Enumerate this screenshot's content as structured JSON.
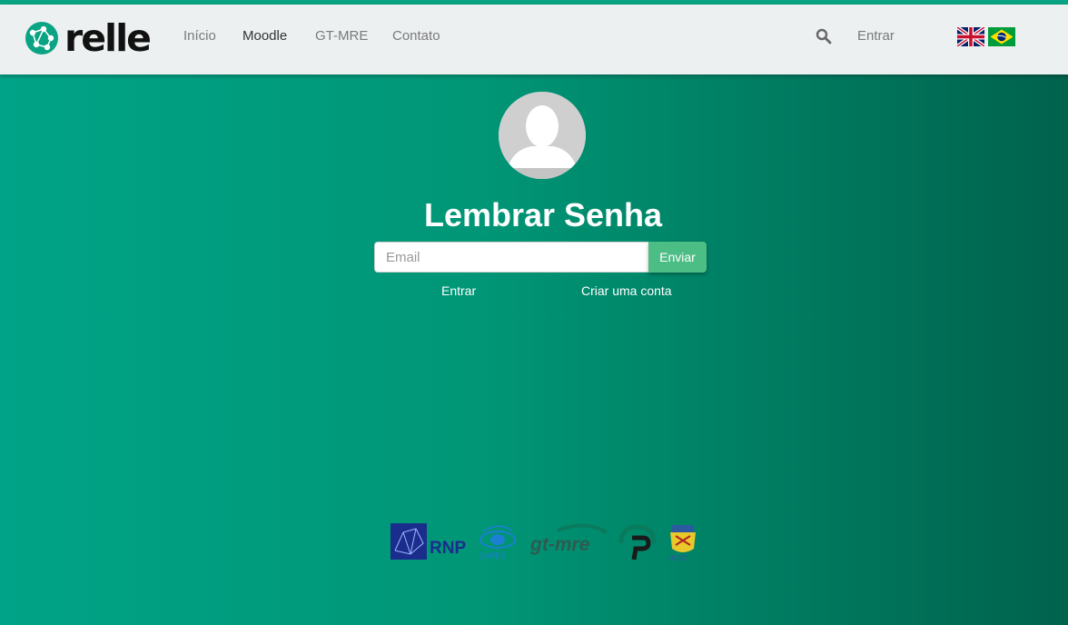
{
  "brand": {
    "name": "relle",
    "accent": "#0aa383"
  },
  "nav": {
    "items": [
      {
        "label": "Início",
        "active": false
      },
      {
        "label": "Moodle",
        "active": true
      },
      {
        "label": "GT-MRE",
        "active": false
      },
      {
        "label": "Contato",
        "active": false
      }
    ],
    "login_label": "Entrar",
    "search_icon": "search-icon",
    "languages": [
      "english-flag-icon",
      "brazil-flag-icon"
    ]
  },
  "page": {
    "title": "Lembrar Senha",
    "email_placeholder": "Email",
    "email_value": "",
    "submit_label": "Enviar",
    "submit_color": "#4dbd86",
    "login_link": "Entrar",
    "register_link": "Criar uma conta"
  },
  "partners": {
    "rnp": "RNP",
    "capes": "CAPES",
    "gtmre": "gt-mre",
    "ufsc": "UFSC"
  }
}
